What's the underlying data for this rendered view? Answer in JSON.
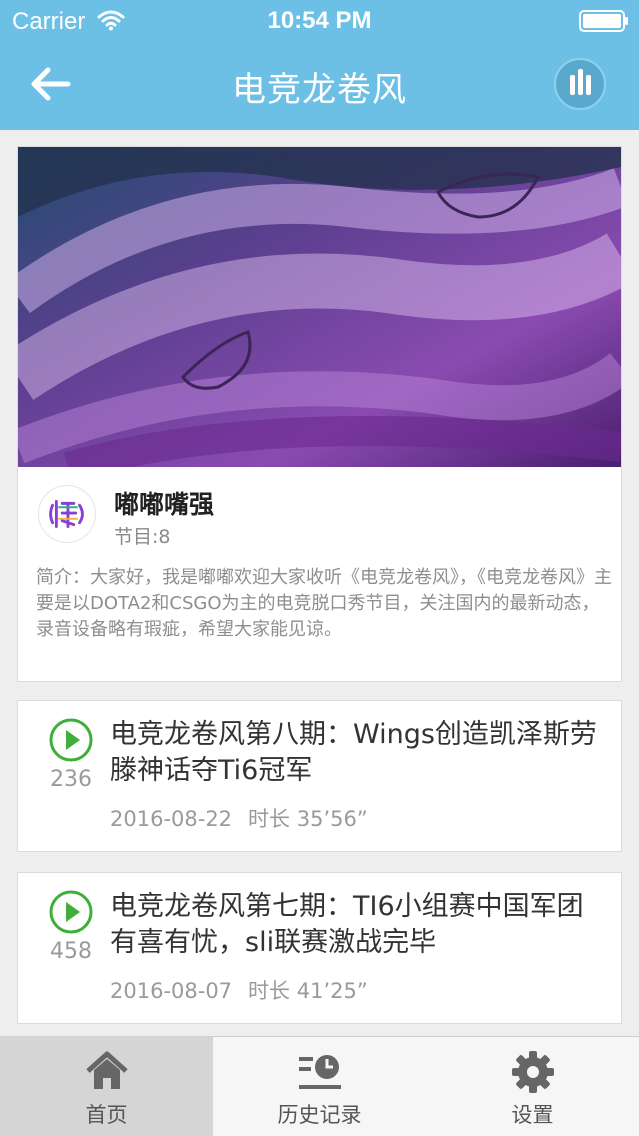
{
  "status_bar": {
    "carrier": "Carrier",
    "time": "10:54 PM"
  },
  "nav": {
    "title": "电竞龙卷风",
    "back_icon": "back-arrow-icon",
    "stats_icon": "bar-chart-icon"
  },
  "profile": {
    "host_name": "嘟嘟嘴强",
    "episode_count": "节目:8",
    "intro": "简介：大家好，我是嘟嘟欢迎大家收听《电竞龙卷风》，《电竞龙卷风》主要是以DOTA2和CSGO为主的电竞脱口秀节目，关注国内的最新动态，录音设备略有瑕疵，希望大家能见谅。"
  },
  "episodes": [
    {
      "title": "电竞龙卷风第八期：Wings创造凯泽斯劳滕神话夺Ti6冠军",
      "plays": "236",
      "date": "2016-08-22",
      "duration": "时长 35’56”"
    },
    {
      "title": "电竞龙卷风第七期：TI6小组赛中国军团有喜有忧，sli联赛激战完毕",
      "plays": "458",
      "date": "2016-08-07",
      "duration": "时长 41’25”"
    }
  ],
  "tabs": [
    {
      "label": "首页",
      "icon": "home-icon",
      "active": true
    },
    {
      "label": "历史记录",
      "icon": "history-icon",
      "active": false
    },
    {
      "label": "设置",
      "icon": "gear-icon",
      "active": false
    }
  ],
  "colors": {
    "nav_bg": "#6cc0e5",
    "play_green": "#3fae3a",
    "tab_active_bg": "#d5d5d5"
  }
}
